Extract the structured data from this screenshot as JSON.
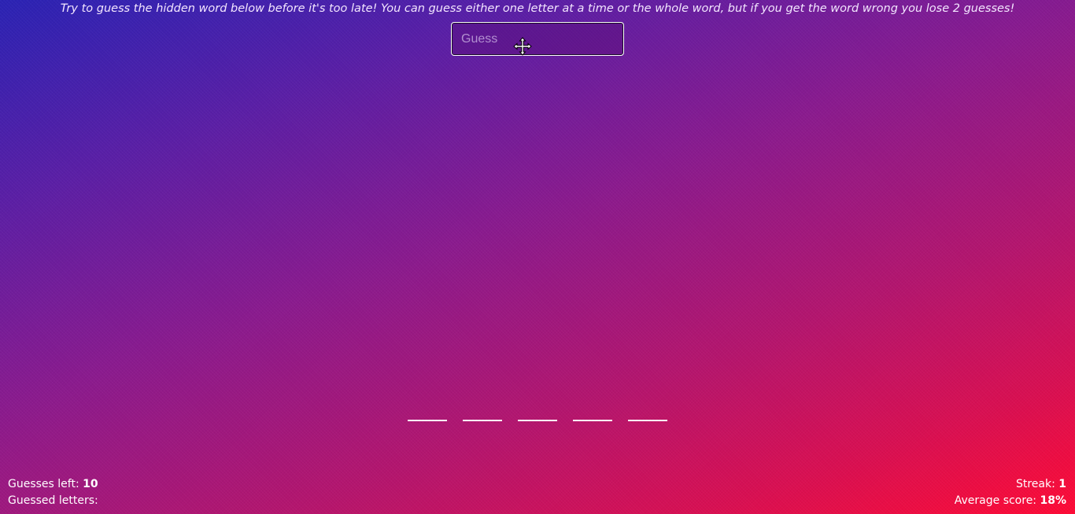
{
  "instructions": "Try to guess the hidden word below before it's too late! You can guess either one letter at a time or the whole word, but if you get the word wrong you lose 2 guesses!",
  "guess_input": {
    "value": "",
    "placeholder": "Guess"
  },
  "word": {
    "letters": [
      "",
      "",
      "",
      "",
      ""
    ]
  },
  "stats": {
    "guesses_left_label": "Guesses left:",
    "guesses_left_value": "10",
    "guessed_letters_label": "Guessed letters:",
    "guessed_letters_value": "",
    "streak_label": "Streak:",
    "streak_value": "1",
    "average_score_label": "Average score:",
    "average_score_value": "18%"
  },
  "colors": {
    "gradient_start": "#2a22b4",
    "gradient_end": "#ff0a35",
    "text": "#ffffff"
  },
  "icons": {
    "cursor": "move-cursor-icon"
  }
}
